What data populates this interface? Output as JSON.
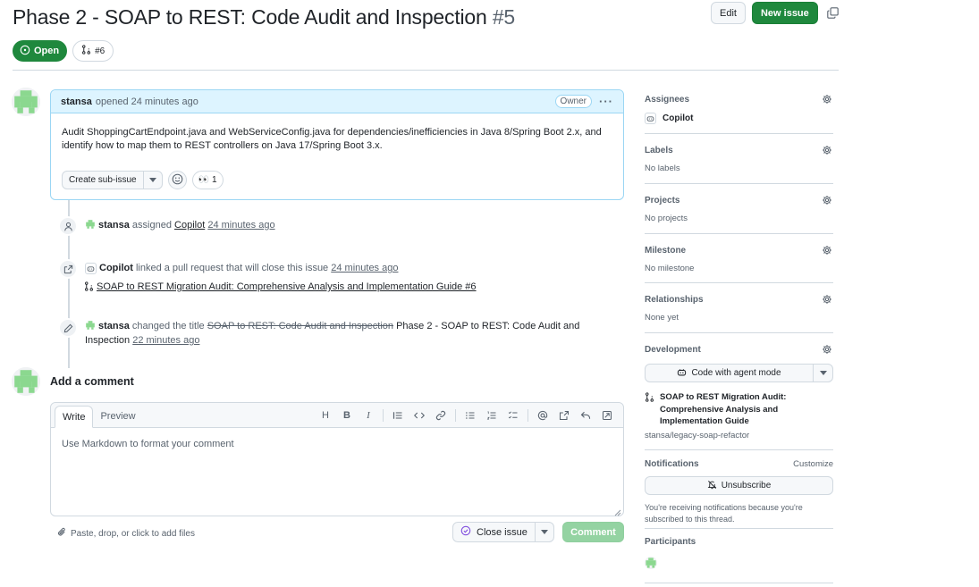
{
  "issue": {
    "title": "Phase 2 - SOAP to REST: Code Audit and Inspection",
    "number": "#5",
    "state": "Open",
    "linked_pr_count": "#6"
  },
  "header_actions": {
    "edit_label": "Edit",
    "new_issue_label": "New issue"
  },
  "comment": {
    "author": "stansa",
    "action": "opened 24 minutes ago",
    "role_badge": "Owner",
    "body": "Audit ShoppingCartEndpoint.java and WebServiceConfig.java for dependencies/inefficiencies in Java 8/Spring Boot 2.x, and identify how to map them to REST controllers on Java 17/Spring Boot 3.x.",
    "create_subissue_label": "Create sub-issue",
    "reaction_emoji": "👀",
    "reaction_count": "1"
  },
  "timeline": {
    "assigned": {
      "actor": "stansa",
      "verb": "assigned",
      "target": "Copilot",
      "time": "24 minutes ago"
    },
    "linked": {
      "actor": "Copilot",
      "verb": "linked a pull request that will close this issue",
      "time": "24 minutes ago",
      "pr_title": "SOAP to REST Migration Audit: Comprehensive Analysis and Implementation Guide #6"
    },
    "renamed": {
      "actor": "stansa",
      "verb": "changed the title",
      "old_title": "SOAP to REST: Code Audit and Inspection",
      "new_title": "Phase 2 - SOAP to REST: Code Audit and Inspection",
      "time": "22 minutes ago"
    }
  },
  "new_comment": {
    "heading": "Add a comment",
    "tab_write": "Write",
    "tab_preview": "Preview",
    "placeholder": "Use Markdown to format your comment",
    "attach_hint": "Paste, drop, or click to add files",
    "close_issue_label": "Close issue",
    "comment_label": "Comment",
    "toolbar_heading_glyph": "H",
    "toolbar_bold_glyph": "B",
    "toolbar_italic_glyph": "I"
  },
  "sidebar": {
    "assignees": {
      "label": "Assignees",
      "value": "Copilot"
    },
    "labels": {
      "label": "Labels",
      "value": "No labels"
    },
    "projects": {
      "label": "Projects",
      "value": "No projects"
    },
    "milestone": {
      "label": "Milestone",
      "value": "No milestone"
    },
    "relationships": {
      "label": "Relationships",
      "value": "None yet"
    },
    "development": {
      "label": "Development",
      "agent_button": "Code with agent mode",
      "pr_title": "SOAP to REST Migration Audit: Comprehensive Analysis and Implementation Guide",
      "repo": "stansa/legacy-soap-refactor"
    },
    "notifications": {
      "label": "Notifications",
      "customize": "Customize",
      "unsubscribe": "Unsubscribe",
      "reason": "You're receiving notifications because you're subscribed to this thread."
    },
    "participants": {
      "label": "Participants"
    }
  },
  "colors": {
    "open_green": "#1f883d",
    "owner_header_bg": "#ddf4ff",
    "owner_border": "#9bd6f4",
    "muted_text": "#59636e",
    "border": "#d1d9e0",
    "identicon_green": "#8bd88f"
  }
}
